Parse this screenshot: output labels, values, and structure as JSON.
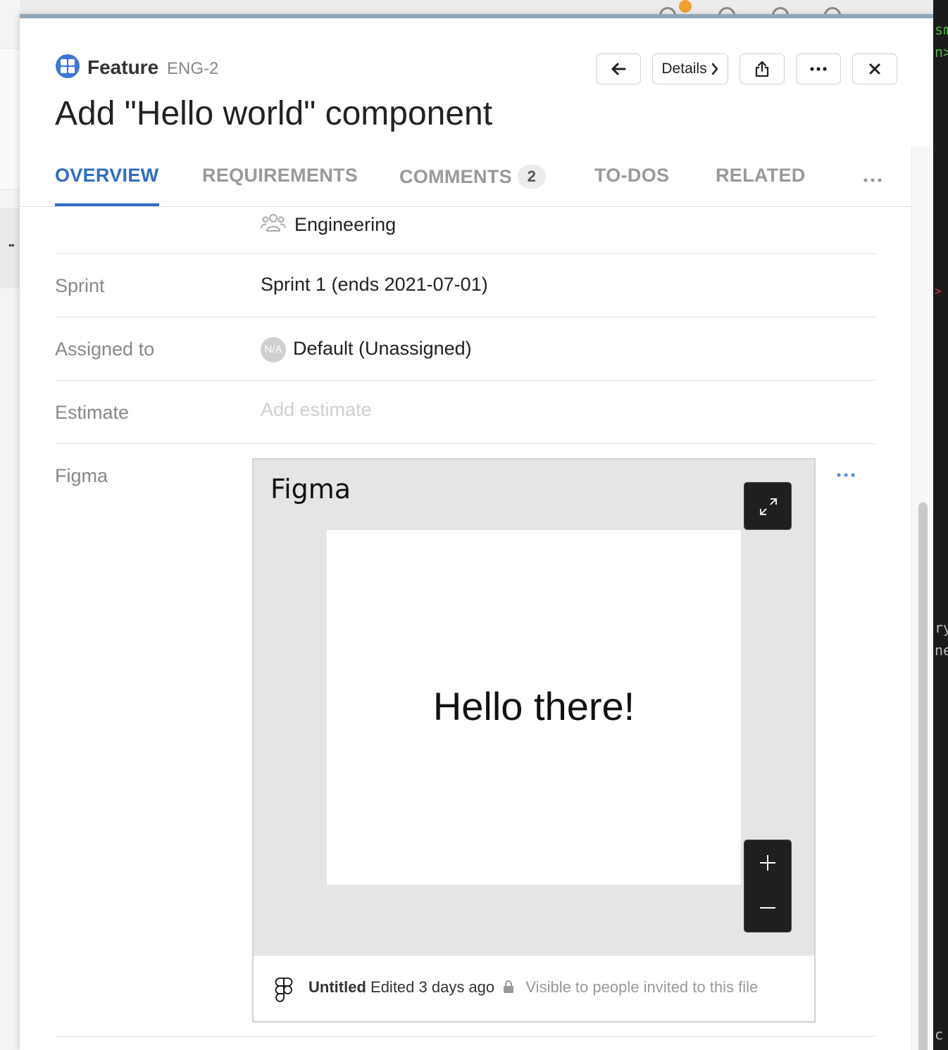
{
  "header": {
    "type_label": "Feature",
    "type_id": "ENG-2",
    "title": "Add \"Hello world\" component",
    "details_label": "Details"
  },
  "tabs": [
    {
      "label": "OVERVIEW",
      "active": true
    },
    {
      "label": "REQUIREMENTS"
    },
    {
      "label": "COMMENTS",
      "count": "2"
    },
    {
      "label": "TO-DOS"
    },
    {
      "label": "RELATED"
    }
  ],
  "fields": {
    "team": {
      "value": "Engineering"
    },
    "sprint": {
      "label": "Sprint",
      "value": "Sprint 1 (ends 2021-07-01)"
    },
    "assigned": {
      "label": "Assigned to",
      "avatar": "N/A",
      "value": "Default (Unassigned)"
    },
    "estimate": {
      "label": "Estimate",
      "placeholder": "Add estimate"
    },
    "figma": {
      "label": "Figma"
    }
  },
  "figma_embed": {
    "logo_text": "Figma",
    "frame_text": "Hello there!",
    "file_name": "Untitled",
    "edited": "Edited 3 days ago",
    "visibility": "Visible to people invited to this file"
  },
  "colors": {
    "accent": "#2f6cc4",
    "type_icon": "#3b78d8"
  },
  "background_terminal": [
    "sm",
    "n>",
    ">",
    "ry",
    "ne",
    "c"
  ]
}
